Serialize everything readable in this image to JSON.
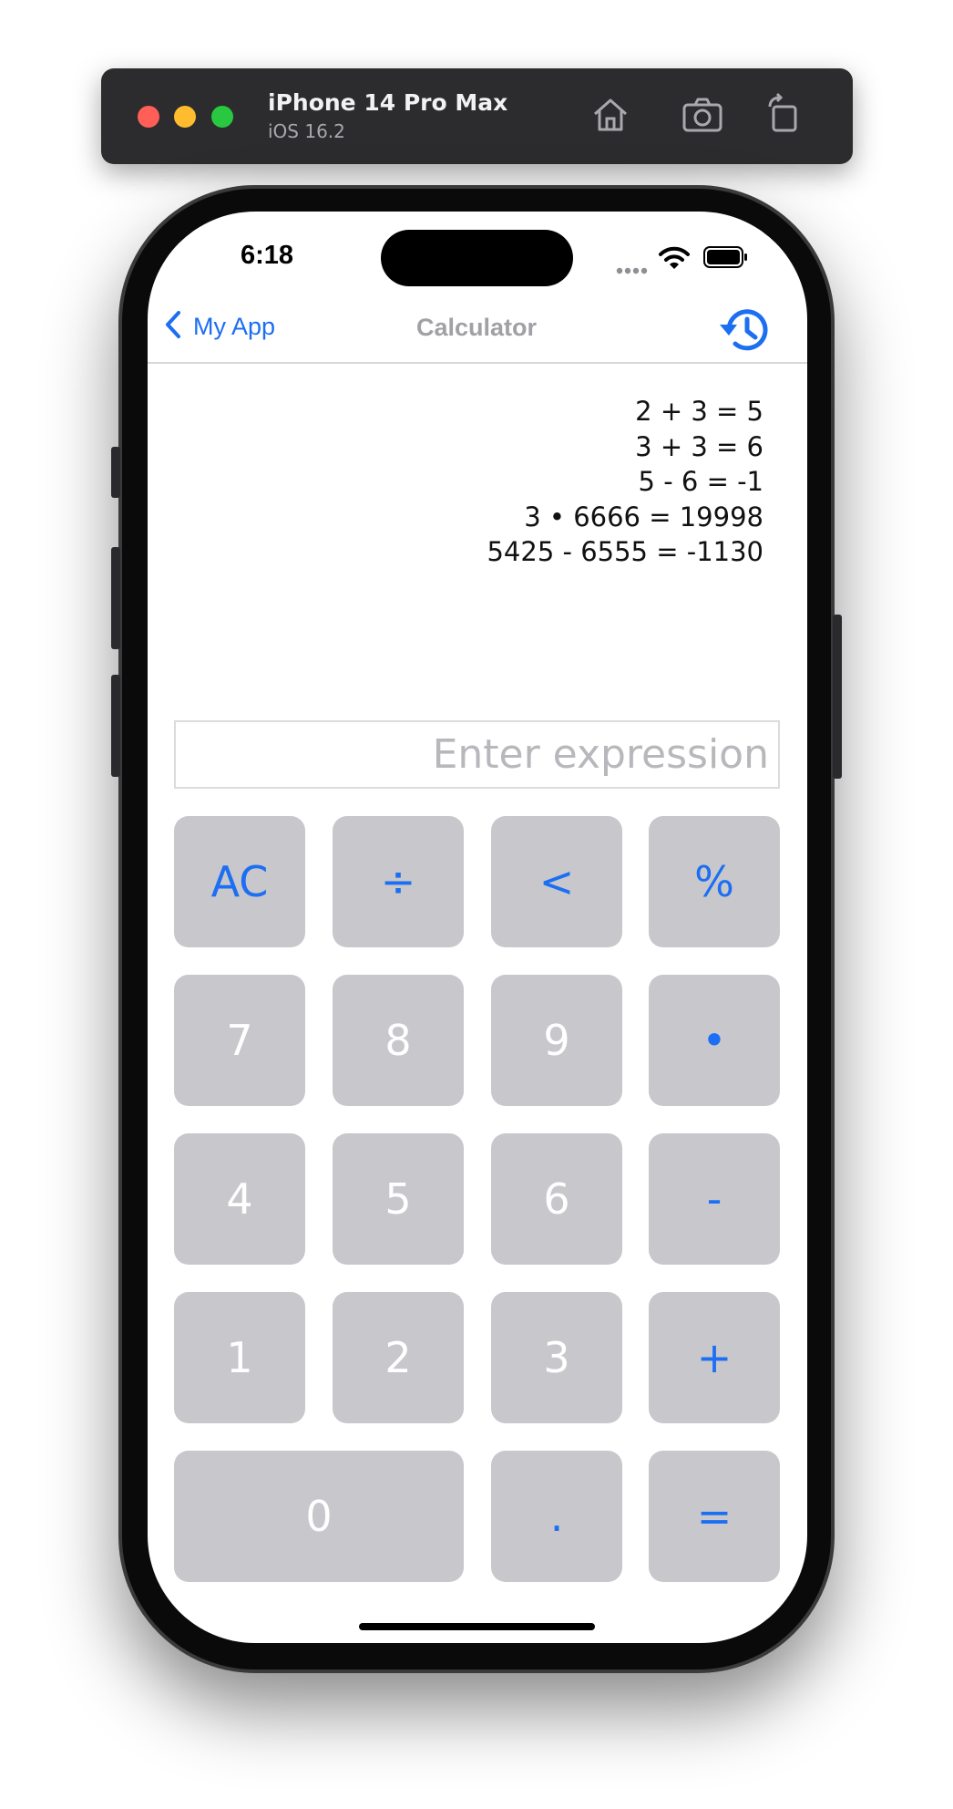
{
  "simulator": {
    "device_name": "iPhone 14 Pro Max",
    "os_version": "iOS 16.2"
  },
  "status_bar": {
    "time": "6:18"
  },
  "nav": {
    "back_label": "My App",
    "title": "Calculator"
  },
  "history": [
    "2 + 3 = 5",
    "3 + 3 = 6",
    "5 - 6 = -1",
    "3 • 6666 = 19998",
    "5425 - 6555 = -1130"
  ],
  "input": {
    "value": "",
    "placeholder": "Enter expression"
  },
  "keypad": {
    "ac": "AC",
    "divide": "÷",
    "backspace": "<",
    "percent": "%",
    "seven": "7",
    "eight": "8",
    "nine": "9",
    "multiply": "•",
    "four": "4",
    "five": "5",
    "six": "6",
    "minus": "-",
    "one": "1",
    "two": "2",
    "three": "3",
    "plus": "+",
    "zero": "0",
    "decimal": ".",
    "equals": "="
  },
  "colors": {
    "accent": "#1c6ef2",
    "key_background": "#c7c7cc",
    "digit_text": "#ffffff"
  }
}
